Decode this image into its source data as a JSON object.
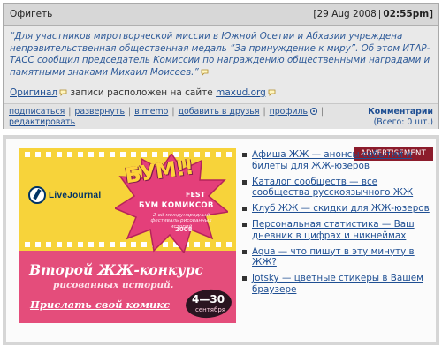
{
  "entry": {
    "title": "Офигеть",
    "date": "[29 Aug 2008",
    "date_sep": "|",
    "time": "02:55pm]",
    "body": "“Для участников миротворческой миссии в Южной Осетии и Абхазии учреждена неправительственная общественная медаль “За принуждение к миру”.  Об этом ИТАР-ТАСС сообщил председатель Комиссии по награждению общественными наградами и памятными знаками Михаил Моисеев.”",
    "source_link": "Оригинал",
    "source_text": " записи расположен на сайте ",
    "source_site": "maxud.org",
    "footer_links": [
      "подписаться",
      "развернуть",
      "в memo",
      "добавить в друзья",
      "профиль",
      "редактировать"
    ],
    "comments_label": "Комментарии",
    "comments_count": "(Всего: 0 шт.)"
  },
  "ad": {
    "tag": "ADVERTISEMENT",
    "banner": {
      "logo": "LiveJournal",
      "boom": "БУМ!!",
      "fest": "FEST",
      "subtitle": "БУМ КОМИКСОВ",
      "small": "2-ой международный фестиваль рисованных историй",
      "year": "2008",
      "headline": "Второй ЖЖ-конкурс",
      "subline": "рисованных историй.",
      "cta": "Прислать свой комикс",
      "dates": "4—30",
      "month": "сентября"
    },
    "links": [
      "Афиша ЖЖ — анонсы событий и билеты для ЖЖ-юзеров",
      "Каталог сообществ — все сообщества русскоязычного ЖЖ",
      "Клуб ЖЖ — скидки для ЖЖ-юзеров",
      "Персональная статистика — Ваш дневник в цифрах и никнеймах",
      "Aqua — что пишут в эту минуту в ЖЖ?",
      "Jotsky — цветные стикеры в Вашем браузере"
    ]
  }
}
